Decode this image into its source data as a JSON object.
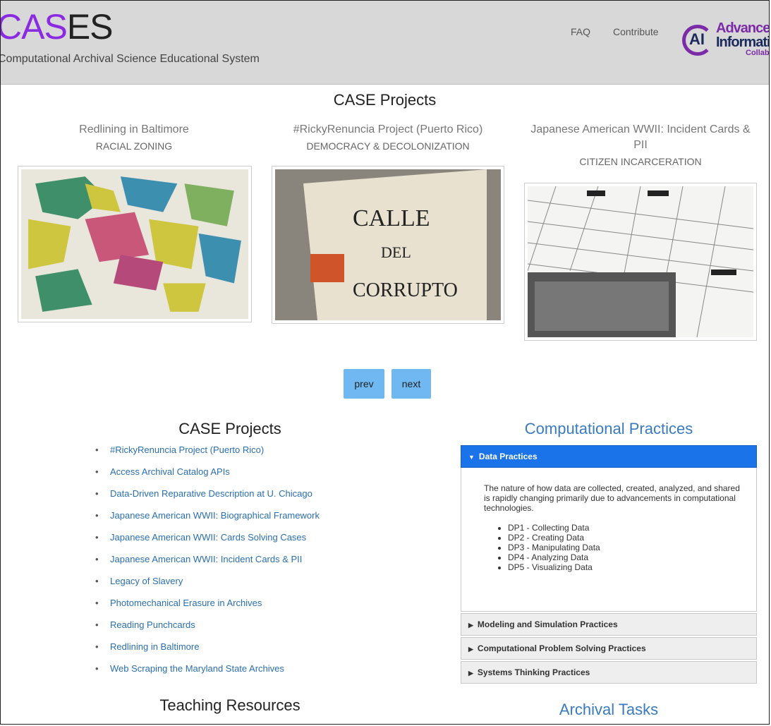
{
  "header": {
    "logo_part1": "CAS",
    "logo_part2": "ES",
    "tagline": "Computational Archival Science Educational System",
    "nav": [
      "FAQ",
      "Contribute"
    ],
    "partner_logo": {
      "line1": "Advanced",
      "line2": "Information",
      "line3": "Collaboratory",
      "mark": "AI"
    }
  },
  "carousel": {
    "title": "CASE Projects",
    "cards": [
      {
        "title": "Redlining in Baltimore",
        "subtitle": "RACIAL ZONING",
        "image": "map-image"
      },
      {
        "title": "#RickyRenuncia Project (Puerto Rico)",
        "subtitle": "DEMOCRACY & DECOLONIZATION",
        "image": "street-sign-image"
      },
      {
        "title": "Japanese American WWII: Incident Cards & PII",
        "subtitle": "CITIZEN INCARCERATION",
        "image": "camp-map-image"
      }
    ],
    "prev_label": "prev",
    "next_label": "next"
  },
  "projects": {
    "heading": "CASE Projects",
    "items": [
      "#RickyRenuncia Project (Puerto Rico)",
      "Access Archival Catalog APIs",
      "Data-Driven Reparative Description at U. Chicago",
      "Japanese American WWII: Biographical Framework",
      "Japanese American WWII: Cards Solving Cases",
      "Japanese American WWII: Incident Cards & PII",
      "Legacy of Slavery",
      "Photomechanical Erasure in Archives",
      "Reading Punchcards",
      "Redlining in Baltimore",
      "Web Scraping the Maryland State Archives"
    ]
  },
  "teaching": {
    "heading": "Teaching Resources"
  },
  "practices": {
    "heading": "Computational Practices",
    "active": {
      "label": "Data Practices",
      "description": "The nature of how data are collected, created, analyzed, and shared is rapidly changing primarily due to advancements in computational technologies.",
      "items": [
        "DP1 - Collecting Data",
        "DP2 - Creating Data",
        "DP3 - Manipulating Data",
        "DP4 - Analyzing Data",
        "DP5 - Visualizing Data"
      ]
    },
    "collapsed": [
      "Modeling and Simulation Practices",
      "Computational Problem Solving Practices",
      "Systems Thinking Practices"
    ]
  },
  "archival": {
    "heading": "Archival Tasks"
  },
  "colors": {
    "accent": "#1a73e8",
    "link": "#2a6fb0",
    "logo_purple": "#8a2be2",
    "button": "#6fb8f2"
  }
}
